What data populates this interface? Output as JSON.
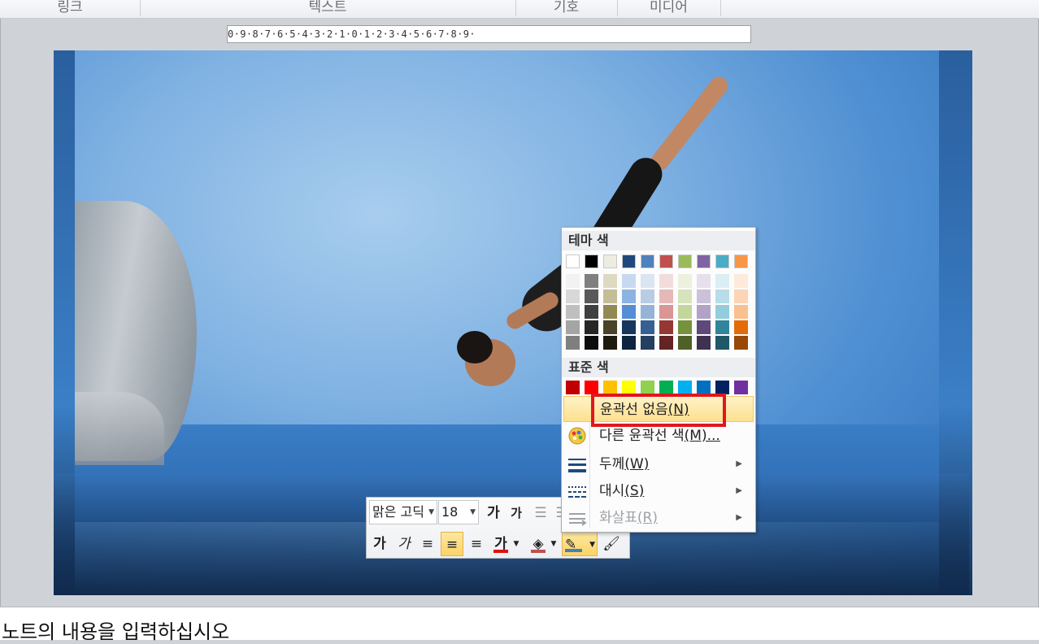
{
  "ribbon": {
    "groups": [
      "링크",
      "텍스트",
      "기호",
      "미디어"
    ]
  },
  "ruler": {
    "marks": "0·9·8·7·6·5·4·3·2·1·0·1·2·3·4·5·6·7·8·9·"
  },
  "mini_toolbar": {
    "font_name": "맑은 고딕",
    "font_size": "18",
    "grow_font": "가",
    "shrink_font": "가",
    "bold": "가",
    "italic": "가",
    "font_color_label": "가",
    "font_color": "#e01010",
    "fill_color": "#c0504d",
    "outline_color": "#4a7ebb"
  },
  "color_menu": {
    "theme_header": "테마 색",
    "standard_header": "표준 색",
    "theme_colors": [
      "#ffffff",
      "#000000",
      "#eeece1",
      "#1f497d",
      "#4f81bd",
      "#c0504d",
      "#9bbb59",
      "#8064a2",
      "#4bacc6",
      "#f79646"
    ],
    "theme_shades": [
      [
        "#f2f2f2",
        "#d8d8d8",
        "#bfbfbf",
        "#a5a5a5",
        "#7f7f7f"
      ],
      [
        "#7f7f7f",
        "#595959",
        "#3f3f3f",
        "#262626",
        "#0c0c0c"
      ],
      [
        "#ddd9c3",
        "#c4bd97",
        "#938953",
        "#494429",
        "#1d1b10"
      ],
      [
        "#c6d9f0",
        "#8db3e2",
        "#548dd4",
        "#17365d",
        "#0f243e"
      ],
      [
        "#dbe5f1",
        "#b8cce4",
        "#95b3d7",
        "#366092",
        "#244061"
      ],
      [
        "#f2dcdb",
        "#e5b9b7",
        "#d99694",
        "#953734",
        "#632423"
      ],
      [
        "#ebf1dd",
        "#d7e3bc",
        "#c3d69b",
        "#76923c",
        "#4f6128"
      ],
      [
        "#e5e0ec",
        "#ccc1d9",
        "#b2a2c7",
        "#5f497a",
        "#3f3151"
      ],
      [
        "#dbeef3",
        "#b7dde8",
        "#92cddc",
        "#31859b",
        "#205867"
      ],
      [
        "#fdeada",
        "#fbd5b5",
        "#fac08f",
        "#e36c09",
        "#974806"
      ]
    ],
    "standard_colors": [
      "#c00000",
      "#ff0000",
      "#ffc000",
      "#ffff00",
      "#92d050",
      "#00b050",
      "#00b0f0",
      "#0070c0",
      "#002060",
      "#7030a0"
    ],
    "items": [
      {
        "label": "윤곽선 없음",
        "key": "(N)"
      },
      {
        "label": "다른 윤곽선 색",
        "key": "(M)..."
      },
      {
        "label": "두께",
        "key": "(W)"
      },
      {
        "label": "대시",
        "key": "(S)"
      },
      {
        "label": "화살표",
        "key": "(R)"
      }
    ]
  },
  "notes": {
    "placeholder": "노트의 내용을 입력하십시오"
  }
}
